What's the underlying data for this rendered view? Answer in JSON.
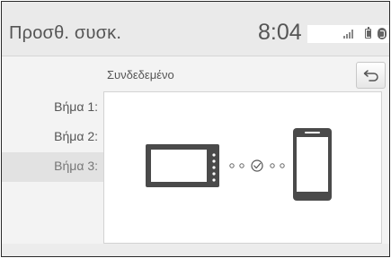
{
  "header": {
    "title": "Προσθ. συσκ.",
    "time": "8:04"
  },
  "status_icons": [
    "signal-icon",
    "battery-icon",
    "bluetooth-icon"
  ],
  "subheader": {
    "status_label": "Συνδεδεμένο"
  },
  "steps": [
    {
      "label": "Βήμα 1:"
    },
    {
      "label": "Βήμα 2:"
    },
    {
      "label": "Βήμα 3:",
      "selected": true
    }
  ],
  "illustration": {
    "left_device": "head-unit-icon",
    "connector": "check-icon",
    "right_device": "smartphone-icon"
  },
  "colors": {
    "header_bg": "#eaeaea",
    "panel_bg": "#ffffff",
    "selected_step_bg": "#e2e2e2",
    "text": "#555555"
  }
}
